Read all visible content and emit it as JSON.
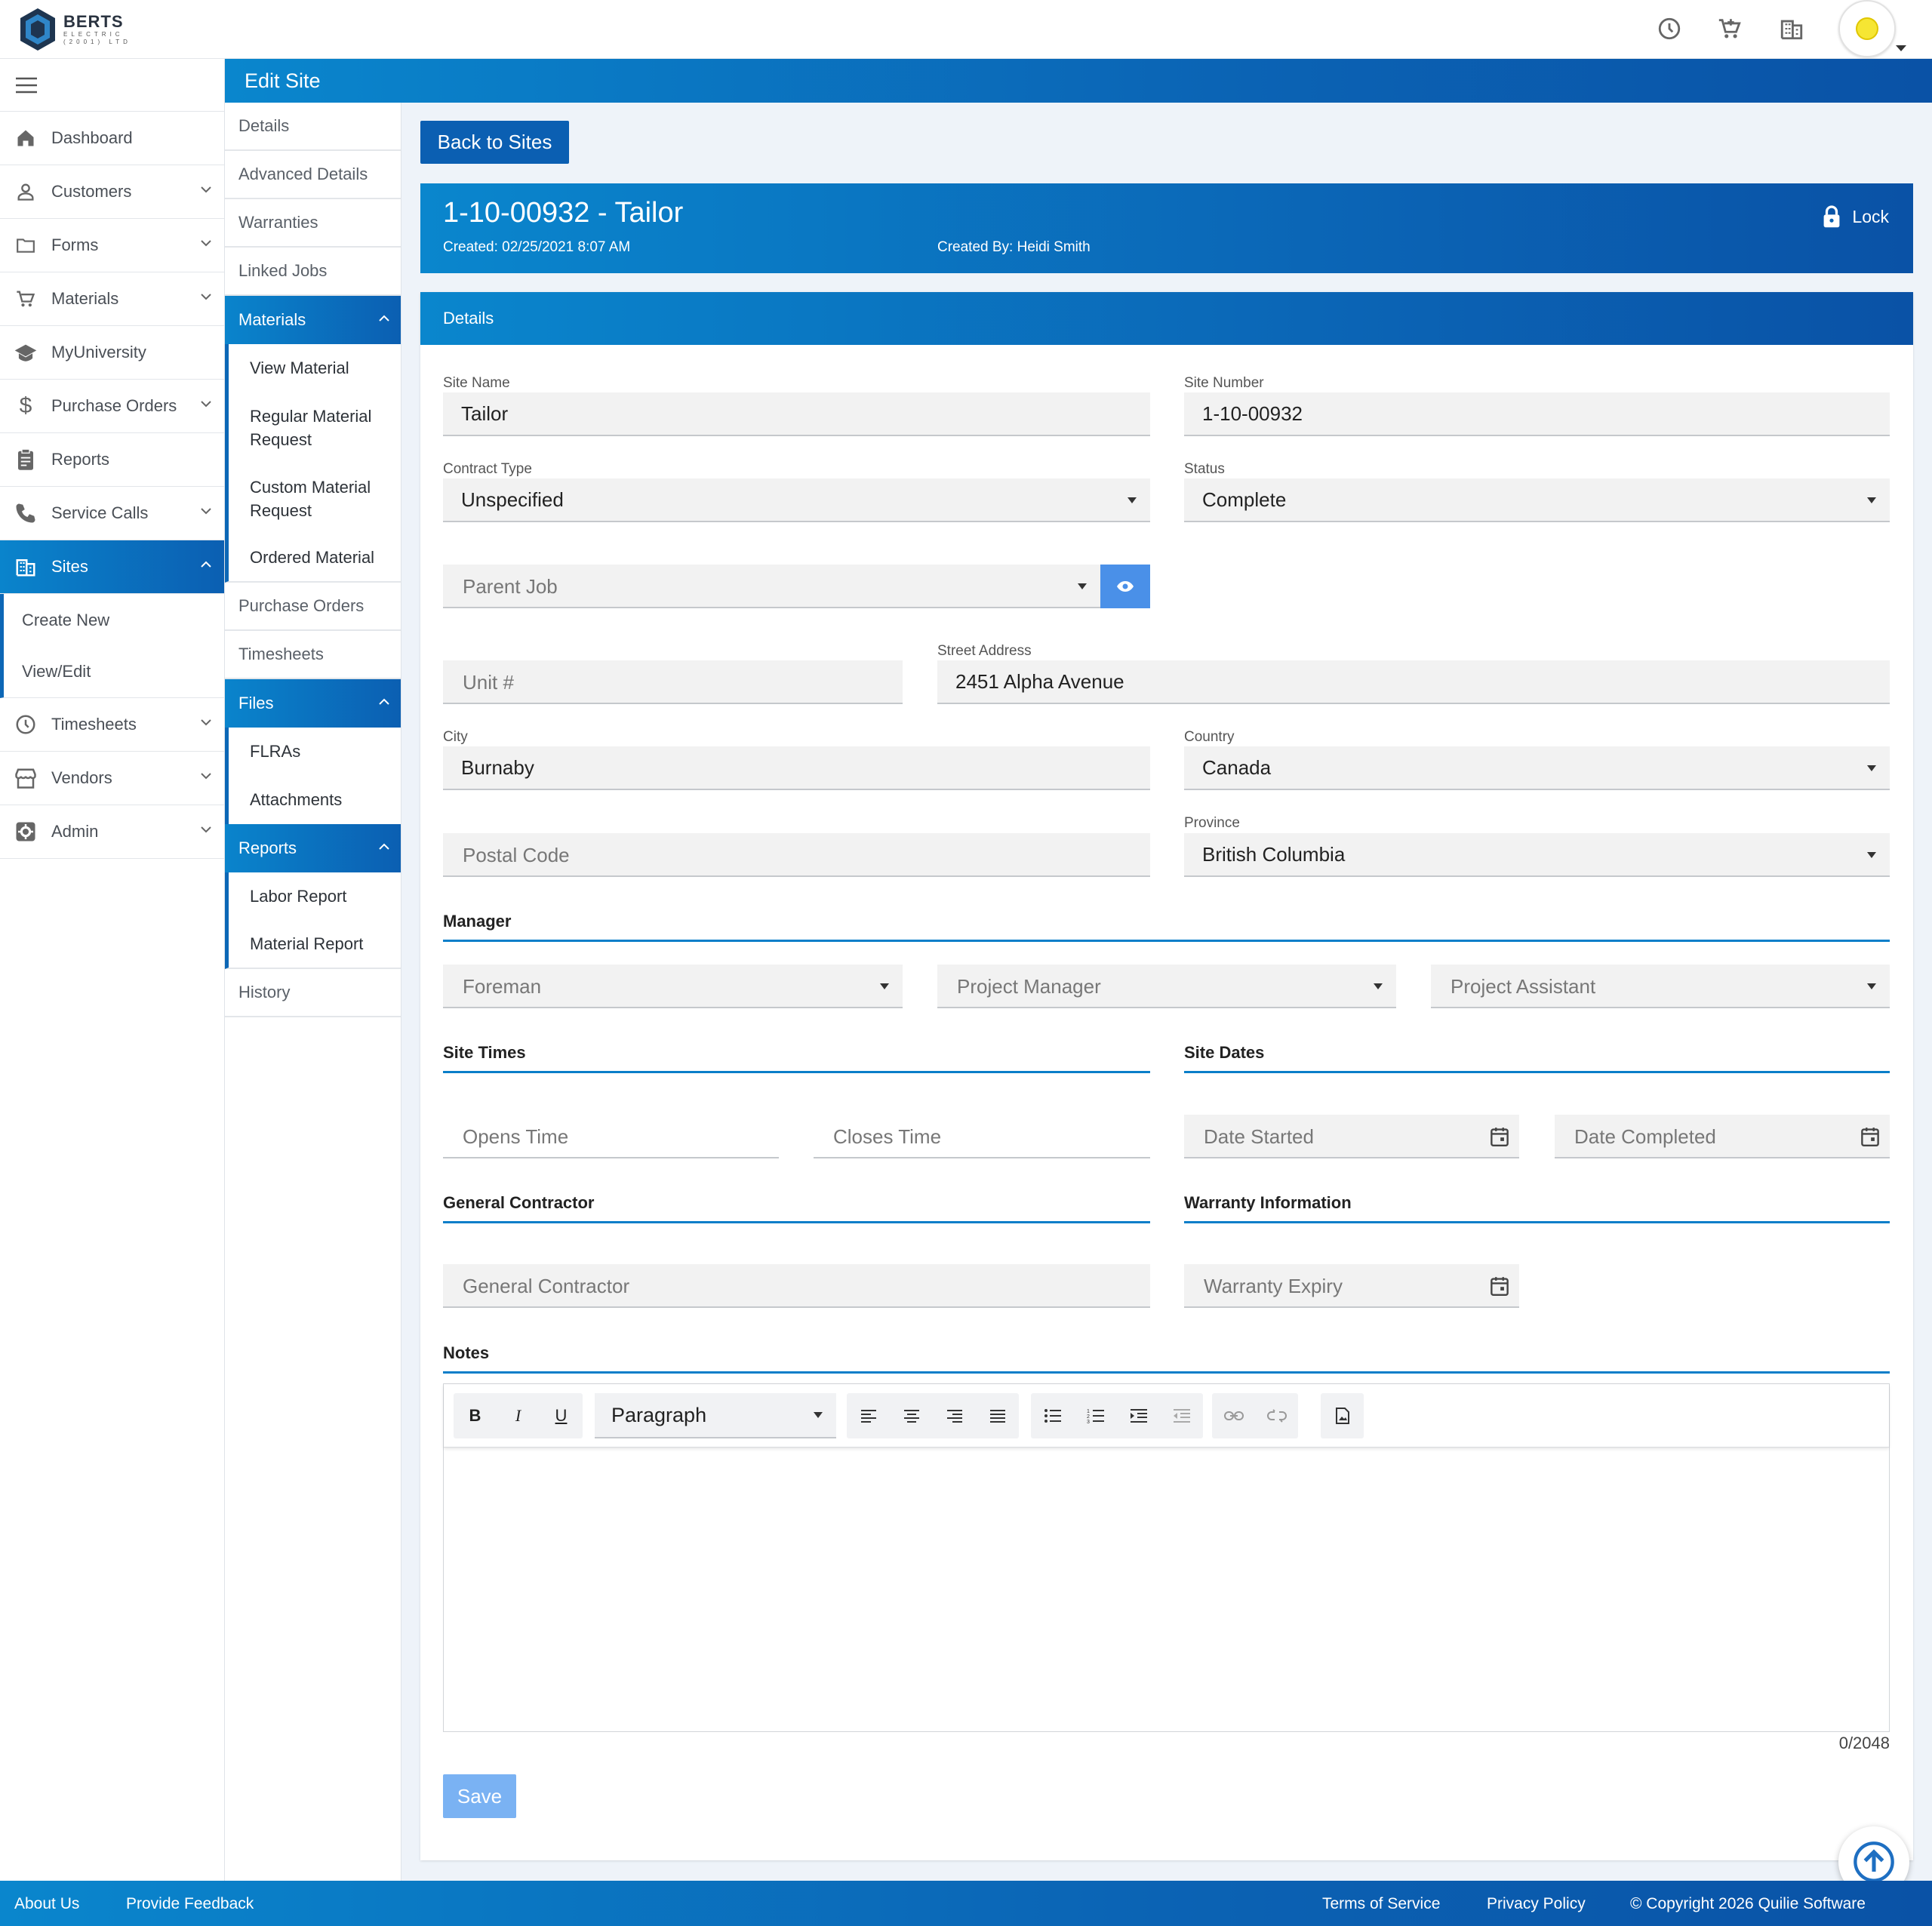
{
  "brand": {
    "name": "BERTS",
    "sub": "ELECTRIC",
    "sub2": "(2001) LTD"
  },
  "topbar": {
    "icons": [
      "history-icon",
      "cart-icon",
      "building-icon"
    ],
    "avatar": "user-avatar"
  },
  "sidebar": {
    "items": [
      {
        "label": "Dashboard",
        "icon": "home-icon"
      },
      {
        "label": "Customers",
        "icon": "person-icon"
      },
      {
        "label": "Forms",
        "icon": "folder-icon"
      },
      {
        "label": "Materials",
        "icon": "cart-icon"
      },
      {
        "label": "MyUniversity",
        "icon": "graduation-cap-icon"
      },
      {
        "label": "Purchase Orders",
        "icon": "dollar-icon"
      },
      {
        "label": "Reports",
        "icon": "clipboard-icon"
      },
      {
        "label": "Service Calls",
        "icon": "phone-icon"
      },
      {
        "label": "Sites",
        "icon": "building-icon"
      },
      {
        "label": "Timesheets",
        "icon": "clock-icon"
      },
      {
        "label": "Vendors",
        "icon": "store-icon"
      },
      {
        "label": "Admin",
        "icon": "gear-icon"
      }
    ],
    "sites_sub": [
      "Create New",
      "View/Edit"
    ]
  },
  "page": {
    "title": "Edit Site",
    "back_label": "Back to Sites"
  },
  "subnav": {
    "details": "Details",
    "advanced": "Advanced Details",
    "warranties": "Warranties",
    "linked_jobs": "Linked Jobs",
    "materials": "Materials",
    "view_material": "View Material",
    "regular_material": "Regular Material Request",
    "custom_material": "Custom Material Request",
    "ordered_material": "Ordered Material",
    "purchase_orders": "Purchase Orders",
    "timesheets": "Timesheets",
    "files": "Files",
    "flras": "FLRAs",
    "attachments": "Attachments",
    "reports": "Reports",
    "labor_report": "Labor Report",
    "material_report": "Material Report",
    "history": "History"
  },
  "site": {
    "title": "1-10-00932 - Tailor",
    "created": "Created: 02/25/2021 8:07 AM",
    "created_by": "Created By: Heidi Smith",
    "lock_label": "Lock"
  },
  "details": {
    "header": "Details",
    "site_name_label": "Site Name",
    "site_name": "Tailor",
    "site_number_label": "Site Number",
    "site_number": "1-10-00932",
    "contract_type_label": "Contract Type",
    "contract_type": "Unspecified",
    "status_label": "Status",
    "status": "Complete",
    "parent_job_ph": "Parent Job",
    "unit_ph": "Unit #",
    "street_label": "Street Address",
    "street": "2451 Alpha Avenue",
    "city_label": "City",
    "city": "Burnaby",
    "country_label": "Country",
    "country": "Canada",
    "postal_ph": "Postal Code",
    "province_label": "Province",
    "province": "British Columbia"
  },
  "manager": {
    "heading": "Manager",
    "foreman_ph": "Foreman",
    "pm_ph": "Project Manager",
    "pa_ph": "Project Assistant"
  },
  "times": {
    "heading": "Site Times",
    "opens_ph": "Opens Time",
    "closes_ph": "Closes Time"
  },
  "dates": {
    "heading": "Site Dates",
    "started_ph": "Date Started",
    "completed_ph": "Date Completed"
  },
  "gc": {
    "heading": "General Contractor",
    "ph": "General Contractor"
  },
  "warranty": {
    "heading": "Warranty Information",
    "ph": "Warranty Expiry"
  },
  "notes": {
    "heading": "Notes",
    "format": "Paragraph",
    "counter": "0/2048",
    "bold": "B",
    "italic": "I",
    "underline": "U"
  },
  "save_label": "Save",
  "footer": {
    "about": "About Us",
    "feedback": "Provide Feedback",
    "terms": "Terms of Service",
    "privacy": "Privacy Policy",
    "copyright": "© Copyright 2026 Quilie Software"
  },
  "colors": {
    "primary": "#0b63b4",
    "accent": "#0a86cd",
    "save": "#7ab2f3",
    "eye": "#4a90e8"
  }
}
